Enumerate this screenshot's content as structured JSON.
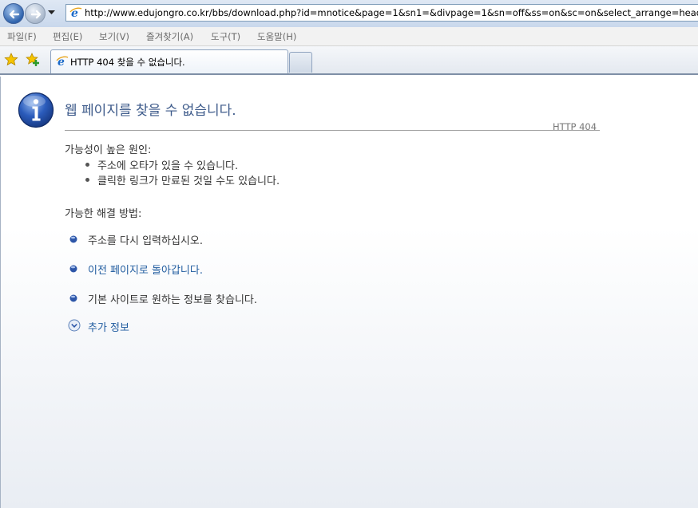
{
  "browser": {
    "address": "http://www.edujongro.co.kr/bbs/download.php?id=mnotice&page=1&sn1=&divpage=1&sn=off&ss=on&sc=on&select_arrange=headnum&",
    "menu": [
      "파일(F)",
      "편집(E)",
      "보기(V)",
      "즐겨찾기(A)",
      "도구(T)",
      "도움말(H)"
    ],
    "tab_title": "HTTP 404 찾을 수 없습니다."
  },
  "page": {
    "title": "웹 페이지를 찾을 수 없습니다.",
    "code": "HTTP 404",
    "causes_heading": "가능성이 높은 원인:",
    "causes": [
      "주소에 오타가 있을 수 있습니다.",
      "클릭한 링크가 만료된 것일 수도 있습니다."
    ],
    "solutions_heading": "가능한 해결 방법:",
    "solutions": [
      "주소를 다시 입력하십시오.",
      "이전 페이지로 돌아갑니다.",
      "기본 사이트로  원하는 정보를 찾습니다."
    ],
    "more_info": "추가 정보"
  },
  "colors": {
    "title": "#3d5a8a",
    "link": "#1f5b9f",
    "bullet": "#2d56a8"
  }
}
